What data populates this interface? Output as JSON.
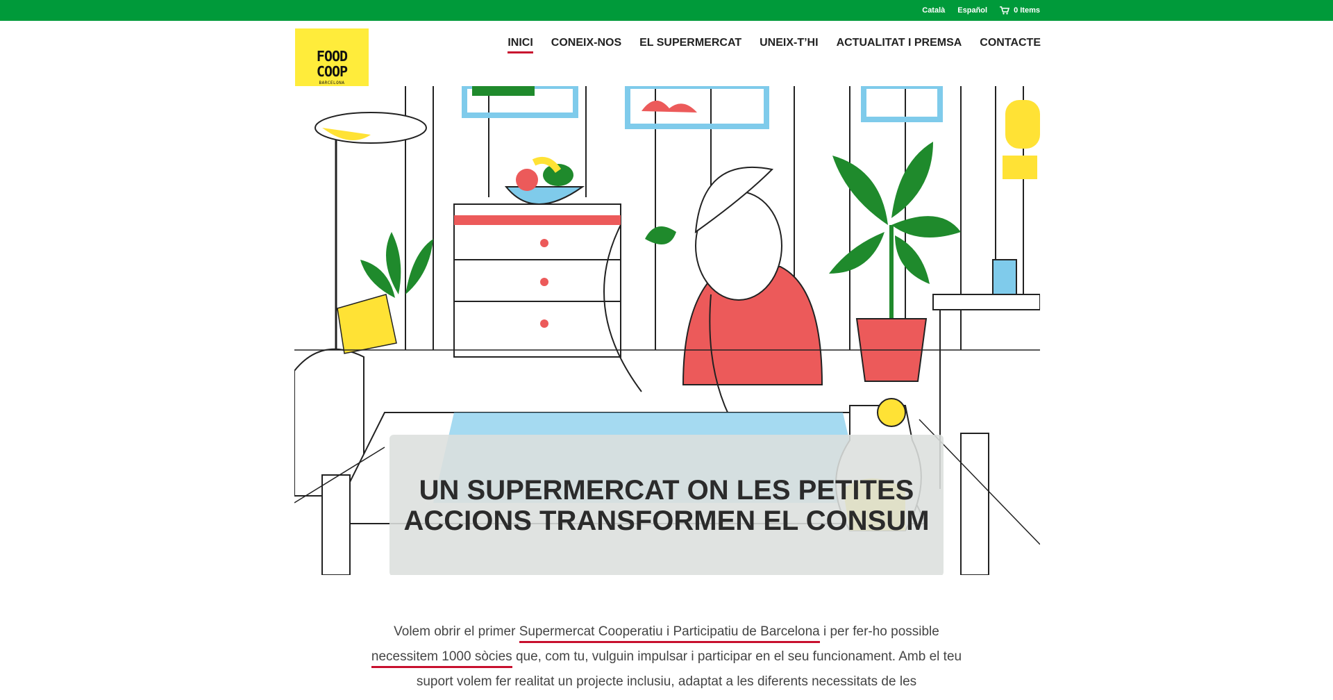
{
  "topbar": {
    "lang_ca": "Català",
    "lang_es": "Español",
    "cart_label": "0 Items",
    "bg_color": "#009a3a"
  },
  "logo": {
    "line1": "FOOD",
    "line2": "COOP",
    "line3": "BARCELONA",
    "bg_color": "#ffec3b"
  },
  "nav": {
    "items": [
      {
        "label": "INICI",
        "active": true
      },
      {
        "label": "CONEIX-NOS"
      },
      {
        "label": "EL SUPERMERCAT"
      },
      {
        "label": "UNEIX-T’HI"
      },
      {
        "label": "ACTUALITAT I PREMSA"
      },
      {
        "label": "CONTACTE"
      }
    ],
    "accent_color": "#c8102e"
  },
  "hero": {
    "headline": "UN SUPERMERCAT ON LES PETITES ACCIONS TRANSFORMEN EL CONSUM"
  },
  "intro": {
    "t1": "Volem obrir el primer ",
    "link1": "Supermercat Cooperatiu i Participatiu de Barcelona",
    "t2": " i per fer-ho possible ",
    "link2": "necessitem 1000 sòcies",
    "t3": " que, com tu, vulguin impulsar i participar en el seu funcionament. Amb el teu suport volem fer realitat un projecte inclusiu, adaptat a les diferents necessitats de les"
  }
}
